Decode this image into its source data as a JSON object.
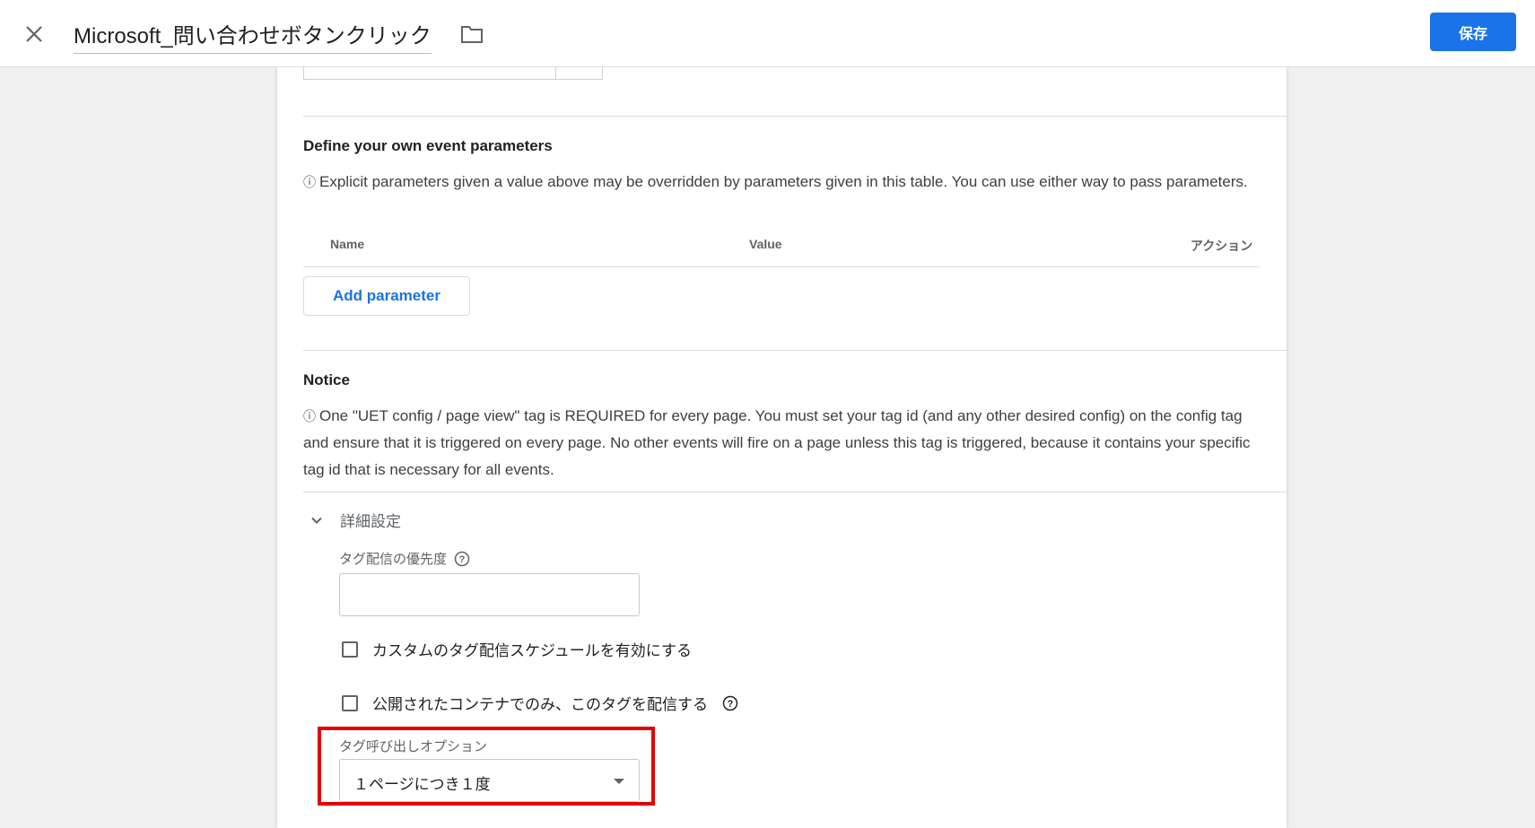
{
  "header": {
    "title": "Microsoft_問い合わせボタンクリック",
    "save_label": "保存"
  },
  "params_section": {
    "title": "Define your own event parameters",
    "info_glyph": "ⓘ",
    "description": "Explicit parameters given a value above may be overridden by parameters given in this table. You can use either way to pass parameters.",
    "columns": [
      "Name",
      "Value",
      "アクション"
    ],
    "add_button": "Add parameter"
  },
  "notice_section": {
    "title": "Notice",
    "info_glyph": "ⓘ",
    "description": "One \"UET config / page view\" tag is REQUIRED for every page. You must set your tag id (and any other desired config) on the config tag and ensure that it is triggered on every page. No other events will fire on a page unless this tag is triggered, because it contains your specific tag id that is necessary for all events."
  },
  "advanced": {
    "label": "詳細設定",
    "priority_label": "タグ配信の優先度",
    "priority_value": "",
    "checkbox_schedule": {
      "label": "カスタムのタグ配信スケジュールを有効にする",
      "checked": false
    },
    "checkbox_published": {
      "label": "公開されたコンテナでのみ、このタグを配信する",
      "checked": false
    },
    "firing_option_label": "タグ呼び出しオプション",
    "firing_option_value": "１ページにつき１度"
  },
  "colors": {
    "primary": "#1a73e8",
    "highlight": "#e30000"
  }
}
